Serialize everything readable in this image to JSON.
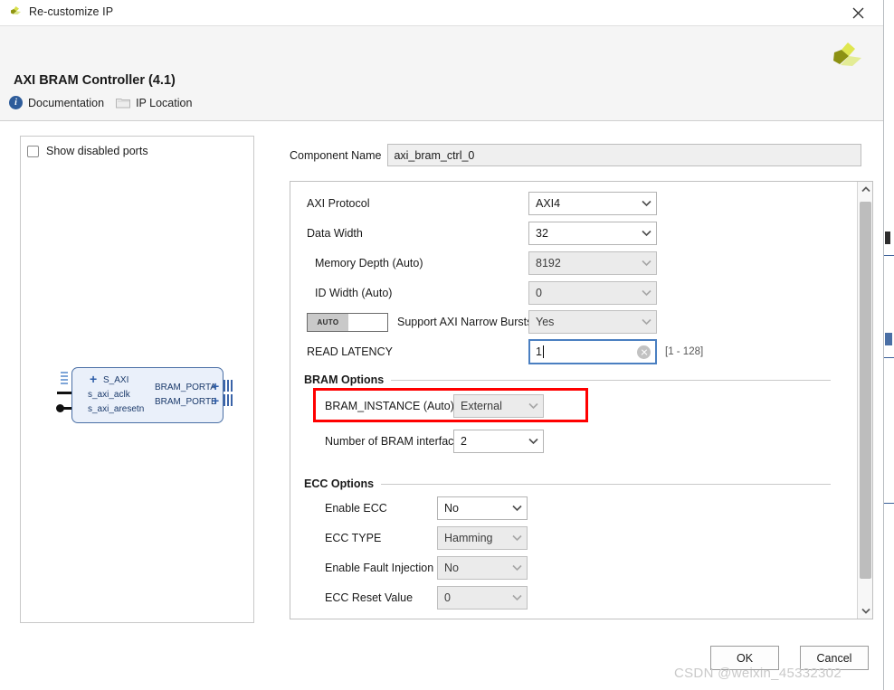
{
  "window": {
    "title": "Re-customize IP",
    "close_label": "✕"
  },
  "header": {
    "ip_title": "AXI BRAM Controller (4.1)",
    "links": [
      {
        "label": "Documentation",
        "icon": "info-icon"
      },
      {
        "label": "IP Location",
        "icon": "folder-icon"
      }
    ]
  },
  "preview": {
    "show_disabled_ports_label": "Show disabled ports",
    "show_disabled_ports_checked": false,
    "block": {
      "left_ports": [
        "S_AXI",
        "s_axi_aclk",
        "s_axi_aresetn"
      ],
      "right_ports": [
        "BRAM_PORTA",
        "BRAM_PORTB"
      ]
    }
  },
  "component": {
    "label": "Component Name",
    "value": "axi_bram_ctrl_0"
  },
  "form": {
    "fields": [
      {
        "label": "AXI Protocol",
        "value": "AXI4",
        "enabled": true
      },
      {
        "label": "Data Width",
        "value": "32",
        "enabled": true
      },
      {
        "label": "Memory Depth (Auto)",
        "value": "8192",
        "enabled": false
      },
      {
        "label": "ID Width (Auto)",
        "value": "0",
        "enabled": false
      },
      {
        "label": "Support AXI Narrow Bursts",
        "value": "Yes",
        "enabled": false,
        "auto_toggle": "AUTO"
      },
      {
        "label": "READ LATENCY",
        "value": "1",
        "range_hint": "[1 - 128]",
        "type": "text",
        "focused": true
      }
    ]
  },
  "bram_options": {
    "section_title": "BRAM Options",
    "fields": [
      {
        "label": "BRAM_INSTANCE (Auto)",
        "value": "External",
        "enabled": false,
        "highlighted": true
      },
      {
        "label": "Number of BRAM interfaces",
        "value": "2",
        "enabled": true
      }
    ]
  },
  "ecc_options": {
    "section_title": "ECC Options",
    "fields": [
      {
        "label": "Enable ECC",
        "value": "No",
        "enabled": true
      },
      {
        "label": "ECC TYPE",
        "value": "Hamming",
        "enabled": false
      },
      {
        "label": "Enable Fault Injection",
        "value": "No",
        "enabled": false
      },
      {
        "label": "ECC Reset Value",
        "value": "0",
        "enabled": false
      }
    ]
  },
  "footer": {
    "ok_label": "OK",
    "cancel_label": "Cancel"
  },
  "watermark": "CSDN @weixin_45332302",
  "colors": {
    "highlight_red": "#ff0000",
    "accent_blue": "#4a7fc1",
    "logo_green": "#c8d64a",
    "block_fill": "#eaf0fa"
  }
}
